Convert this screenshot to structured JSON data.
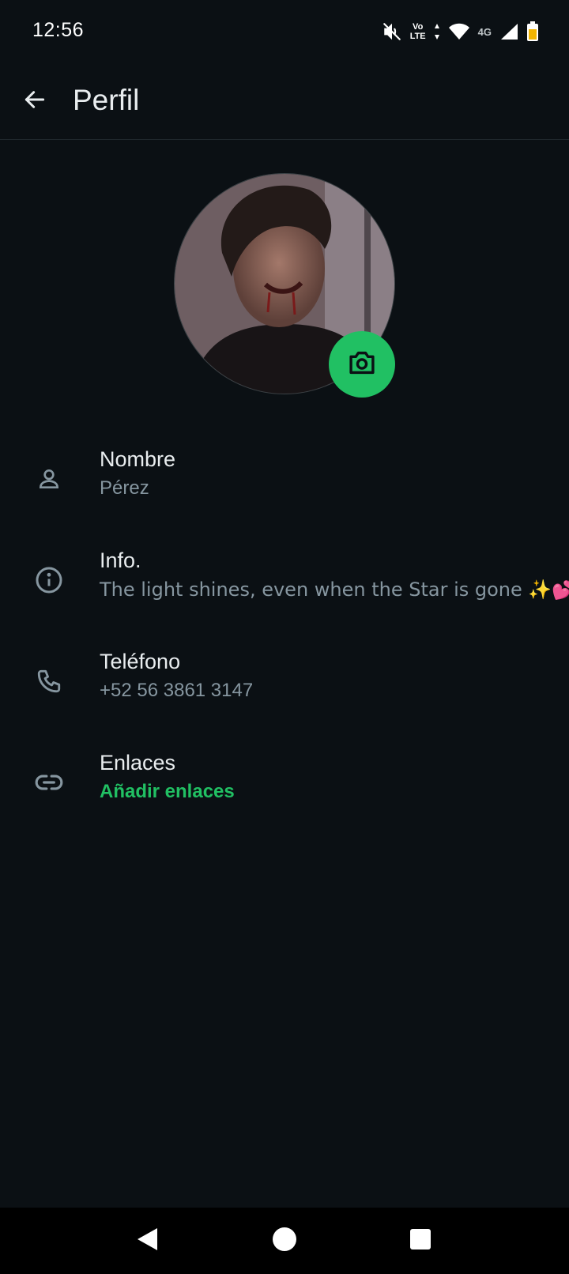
{
  "status_bar": {
    "time": "12:56",
    "volte_top": "Vo",
    "volte_bottom": "LTE",
    "network": "4G",
    "icons": [
      "mute-icon",
      "volte-icon",
      "wifi-icon",
      "signal-icon",
      "battery-icon"
    ]
  },
  "header": {
    "title": "Perfil",
    "back_icon": "arrow-left-icon"
  },
  "profile": {
    "camera_icon": "camera-icon",
    "fields": [
      {
        "title": "Nombre",
        "value": "Pérez",
        "icon": "person-icon"
      },
      {
        "title": "Info.",
        "value": "The light shines, even when the Star is gone ✨💕",
        "icon": "info-icon"
      },
      {
        "title": "Teléfono",
        "value": "+52 56 3861 3147",
        "icon": "phone-icon"
      },
      {
        "title": "Enlaces",
        "value": "Añadir enlaces",
        "icon": "link-icon"
      }
    ]
  },
  "nav_bar": {
    "icons": [
      "nav-back-icon",
      "nav-home-icon",
      "nav-recents-icon"
    ]
  },
  "colors": {
    "background": "#0b1014",
    "accent": "#21c063",
    "primary_text": "#e9edef",
    "secondary_text": "#8696a0"
  }
}
